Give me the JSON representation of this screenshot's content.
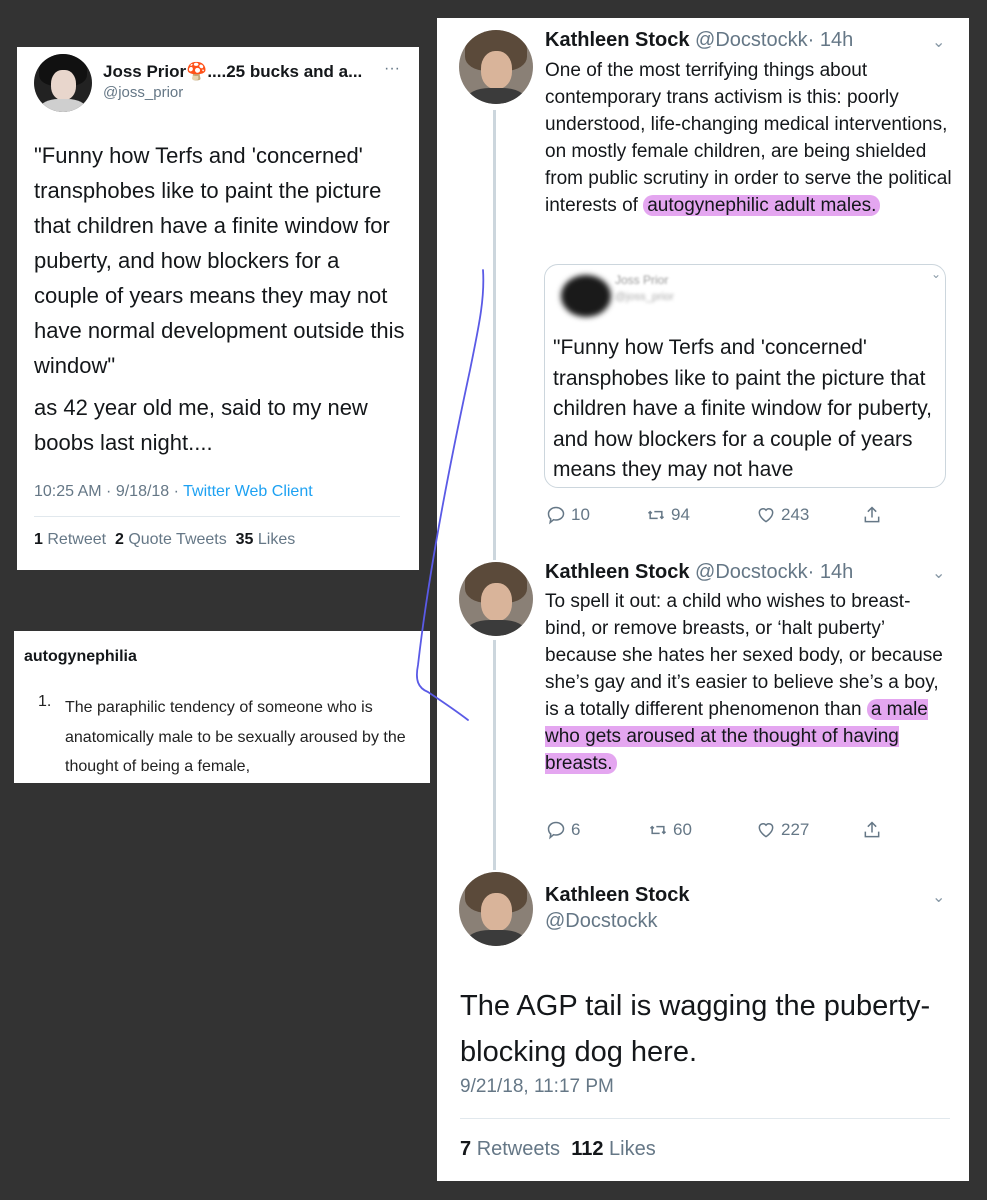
{
  "joss_card": {
    "name": "Joss Prior🍄....25 bucks and a...",
    "handle": "@joss_prior",
    "more": "···",
    "body1": "\"Funny how Terfs and 'concerned' transphobes like to paint the picture that children have a finite window for puberty, and how blockers for a couple of years means they may not have normal development outside this window\"",
    "body2": "as 42 year old me, said to my new boobs last night....",
    "time": "10:25 AM · 9/18/18 ·",
    "client": "Twitter Web Client",
    "retweets_count": "1",
    "retweets_label": "Retweet",
    "quotes_count": "2",
    "quotes_label": "Quote Tweets",
    "likes_count": "35",
    "likes_label": "Likes"
  },
  "definition": {
    "term": "autogynephilia",
    "number": "1.",
    "text": "The paraphilic tendency of someone who is anatomically male to be sexually aroused by the thought of being a female,"
  },
  "tweet1": {
    "name": "Kathleen Stock",
    "handle": "@Docstockk",
    "time": "· 14h",
    "body": "One of the most terrifying things about contemporary trans activism is this: poorly understood, life-changing medical interventions, on mostly female children, are being shielded from public scrutiny in order to serve the political interests of",
    "body_highlight": "autogynephilic adult males.",
    "quote": {
      "name": "Joss Prior",
      "handle": "@joss_prior",
      "text": "\"Funny how Terfs and 'concerned' transphobes like to paint the picture that children have a finite window for puberty, and how blockers for a couple of years means they may not have"
    },
    "replies": "10",
    "retweets": "94",
    "likes": "243"
  },
  "tweet2": {
    "name": "Kathleen Stock",
    "handle": "@Docstockk",
    "time": "· 14h",
    "body": "To spell it out: a child who wishes to breast-bind, or remove breasts, or ‘halt puberty’ because she hates her sexed body, or because she’s gay and it’s easier to believe she’s a boy, is a totally different phenomenon than",
    "body_highlight": "a male who gets aroused at the thought of having breasts.",
    "replies": "6",
    "retweets": "60",
    "likes": "227"
  },
  "tweet3": {
    "name": "Kathleen Stock",
    "handle": "@Docstockk",
    "body": "The AGP tail is wagging the puberty-blocking dog here.",
    "time": "9/21/18, 11:17 PM",
    "retweets_count": "7",
    "retweets_label": "Retweets",
    "likes_count": "112",
    "likes_label": "Likes"
  },
  "colors": {
    "background": "#333333",
    "highlight": "#e4a6f0",
    "link": "#1da1f2",
    "muted": "#657786",
    "annotation_pen": "#5a5ae6"
  }
}
